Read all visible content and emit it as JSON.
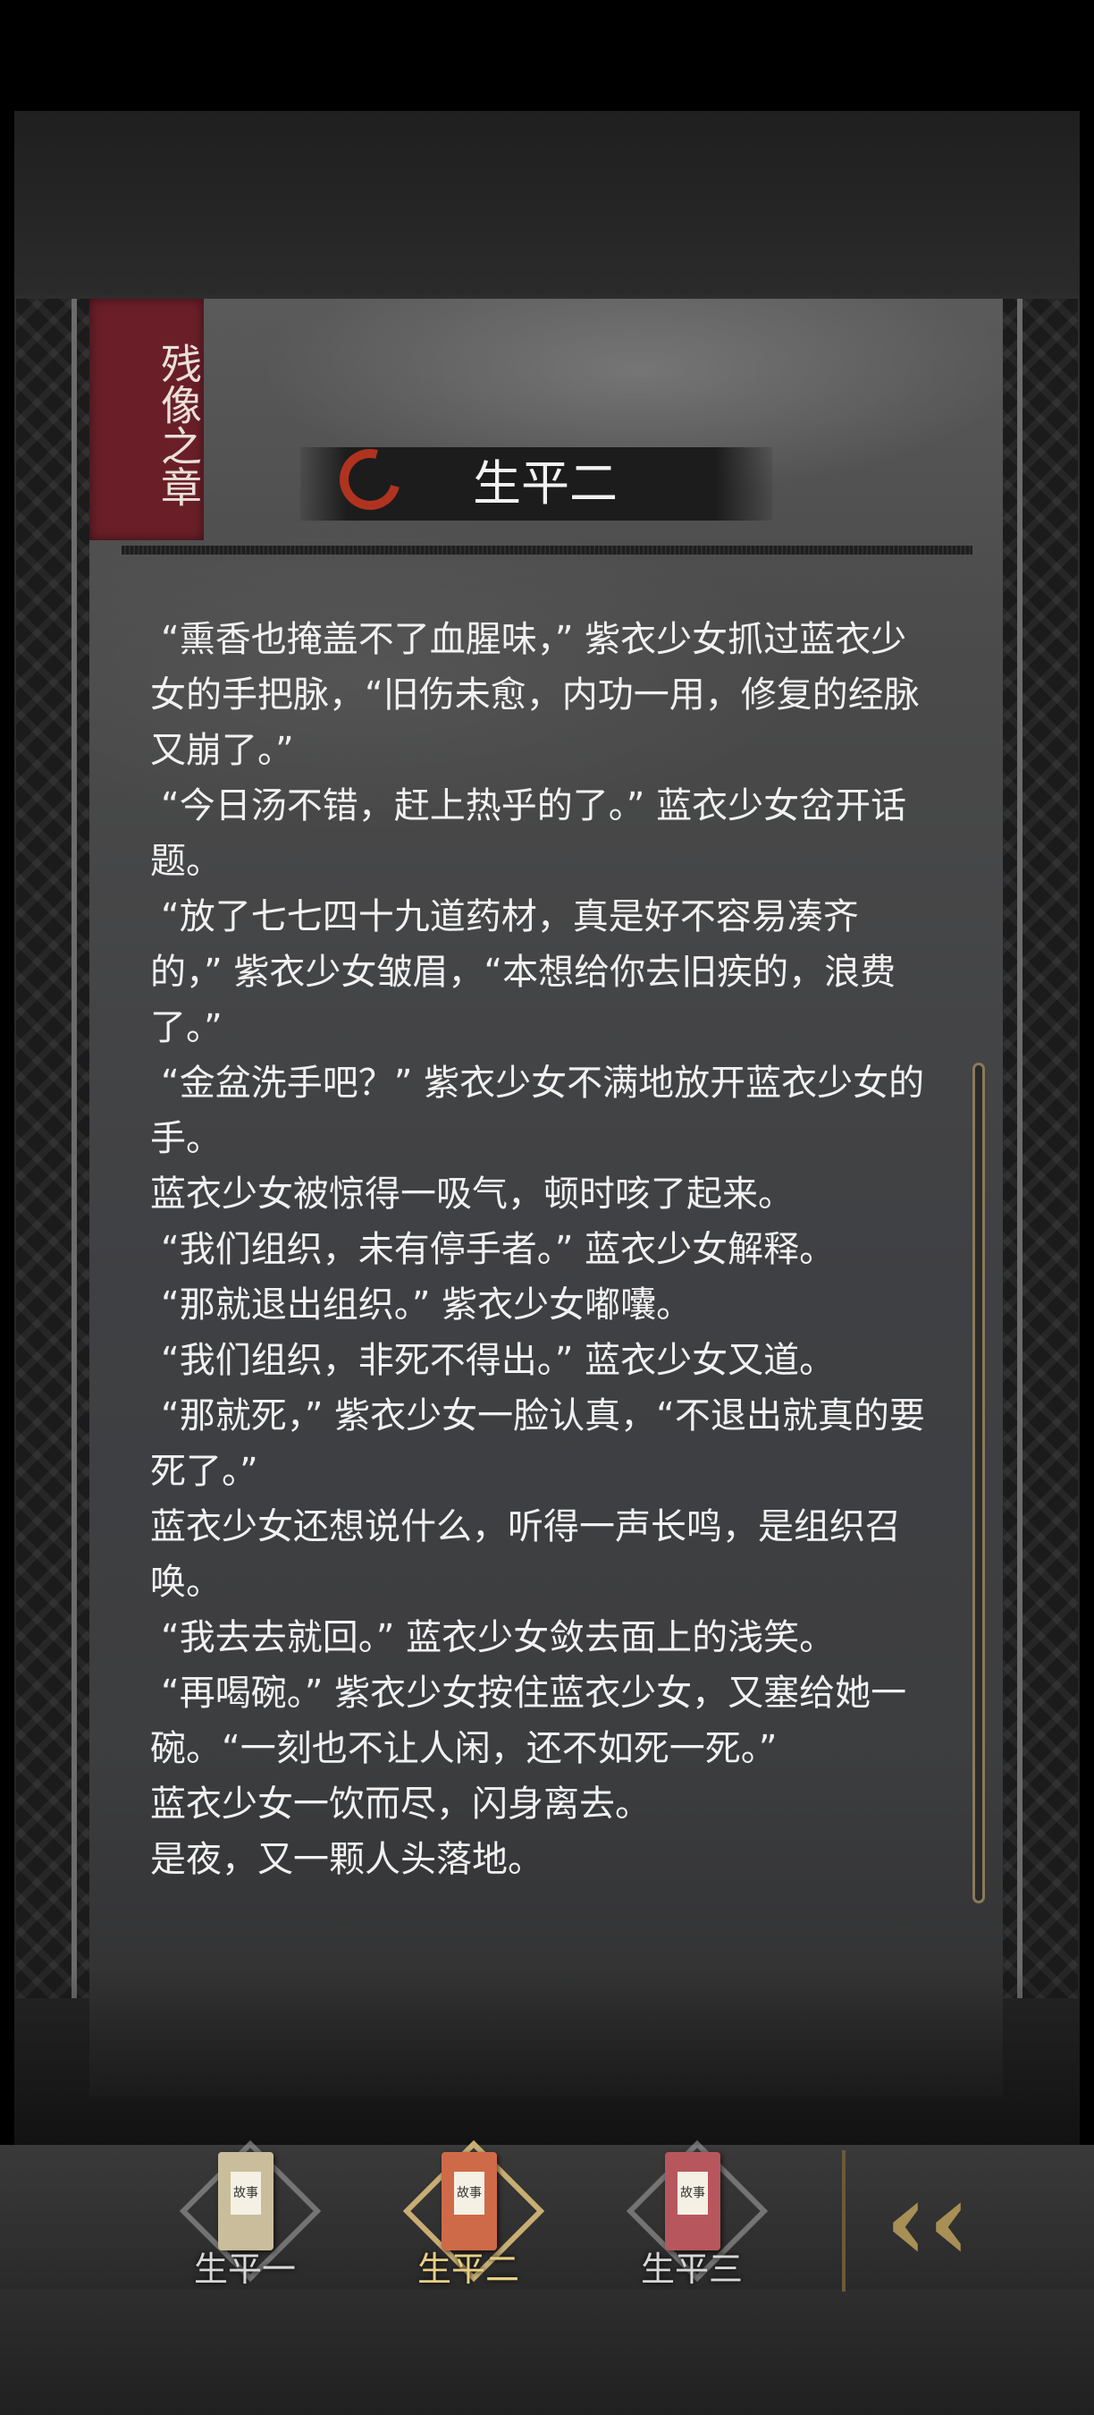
{
  "chapter": {
    "tag": "残像之章",
    "title": "生平二"
  },
  "story": [
    "“熏香也掩盖不了血腥味，” 紫衣少女抓过蓝衣少女的手把脉，“旧伤未愈，内功一用，修复的经脉又崩了。”",
    "“今日汤不错，赶上热乎的了。” 蓝衣少女岔开话题。",
    "“放了七七四十九道药材，真是好不容易凑齐的，” 紫衣少女皱眉，“本想给你去旧疾的，浪费了。”",
    "“金盆洗手吧？” 紫衣少女不满地放开蓝衣少女的手。",
    "蓝衣少女被惊得一吸气，顿时咳了起来。",
    "“我们组织，未有停手者。” 蓝衣少女解释。",
    "“那就退出组织。” 紫衣少女嘟囔。",
    "“我们组织，非死不得出。” 蓝衣少女又道。",
    "“那就死，” 紫衣少女一脸认真，“不退出就真的要死了。”",
    "蓝衣少女还想说什么，听得一声长鸣，是组织召唤。",
    "“我去去就回。” 蓝衣少女敛去面上的浅笑。",
    "“再喝碗。” 紫衣少女按住蓝衣少女，又塞给她一碗。“一刻也不让人闲，还不如死一死。”",
    "蓝衣少女一饮而尽，闪身离去。",
    "是夜，又一颗人头落地。"
  ],
  "tabs": [
    {
      "label": "生平一",
      "book_label": "故事",
      "color": "#c9bd9b",
      "active": false
    },
    {
      "label": "生平二",
      "book_label": "故事",
      "color": "#cf6a48",
      "active": true
    },
    {
      "label": "生平三",
      "book_label": "故事",
      "color": "#b7575d",
      "active": false
    }
  ],
  "back_icon": "double-chevron-left-icon"
}
